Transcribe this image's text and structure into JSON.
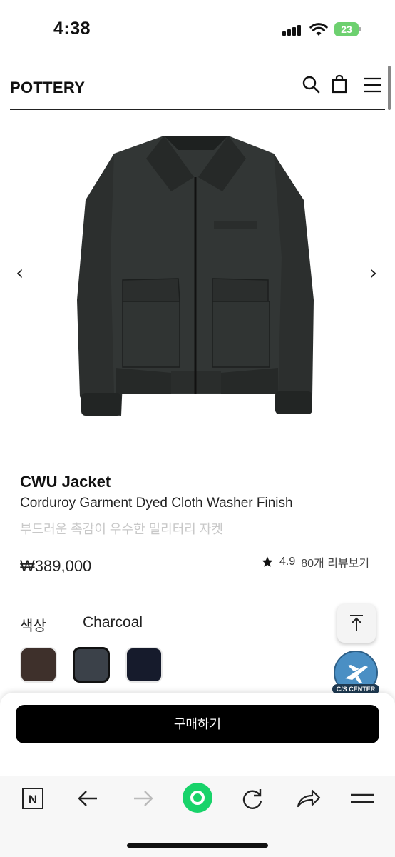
{
  "status_bar": {
    "time": "4:38",
    "battery": "23"
  },
  "header": {
    "brand": "POTTERY"
  },
  "gallery": {
    "prev_arrow": "‹",
    "next_arrow": "›"
  },
  "product": {
    "name": "CWU Jacket",
    "subtitle": "Corduroy Garment Dyed Cloth Washer Finish",
    "description": "부드러운 촉감이 우수한 밀리터리 자켓",
    "price": "₩389,000",
    "rating": "4.9",
    "review_link": "80개 리뷰보기"
  },
  "options": {
    "color_label": "색상",
    "selected_color": "Charcoal",
    "swatches": [
      {
        "color": "#3e302b"
      },
      {
        "color": "#3b4149"
      },
      {
        "color": "#161b2c"
      }
    ]
  },
  "cs_badge": {
    "label": "C/S CENTER"
  },
  "buy_button": {
    "label": "구매하기"
  },
  "toolbar": {
    "n_label": "N"
  }
}
